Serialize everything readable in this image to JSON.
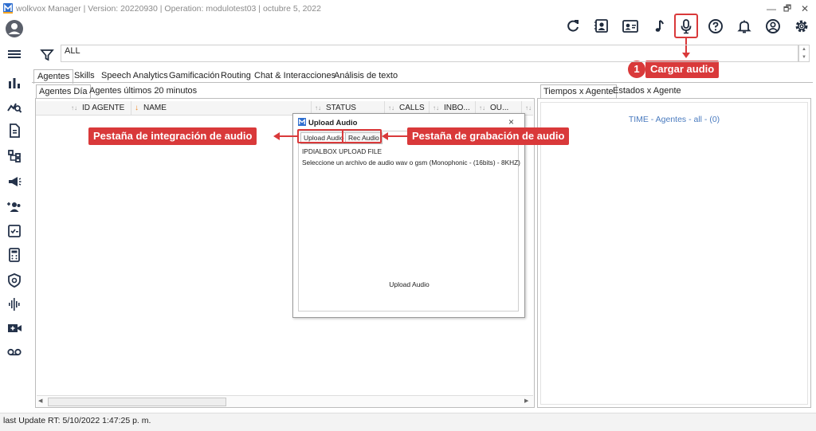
{
  "window": {
    "title": "wolkvox Manager  | Version: 20220930  | Operation: modulotest03  | octubre 5, 2022",
    "minimize": "—",
    "restore": "🗗",
    "close": "✕"
  },
  "filter": {
    "value": "ALL"
  },
  "tabs": [
    "Agentes",
    "Skills",
    "Speech Analytics",
    "Gamificación",
    "Routing",
    "Chat & Interacciones",
    "Análisis de texto"
  ],
  "left_subtabs": [
    "Agentes Día",
    "Agentes últimos 20 minutos"
  ],
  "grid_columns": [
    "ID AGENTE",
    "NAME",
    "STATUS",
    "CALLS",
    "INBO...",
    "OU..."
  ],
  "right_subtabs": [
    "Tiempos x Agente",
    "Estados x Agente"
  ],
  "right_panel": {
    "time_label": "TIME - Agentes - all -  (0)"
  },
  "modal": {
    "title": "Upload Audio",
    "close": "×",
    "tabs": [
      "Upload Audio",
      "Rec Audio"
    ],
    "heading": "IPDIALBOX UPLOAD FILE",
    "instructions": "Seleccione un archivo de audio wav o gsm (Monophonic - (16bits) - 8KHZ)",
    "body_label": "Upload Audio"
  },
  "callouts": {
    "step_number": "1",
    "cargar_audio": "Cargar audio",
    "integracion": "Pestaña de integración de audio",
    "grabacion": "Pestaña de grabación de audio"
  },
  "status_bar": {
    "text": "last Update RT: 5/10/2022 1:47:25 p. m."
  },
  "colors": {
    "accent_red": "#d9393a",
    "link_blue": "#4a7bbf",
    "brand_blue": "#2f6fd0"
  }
}
